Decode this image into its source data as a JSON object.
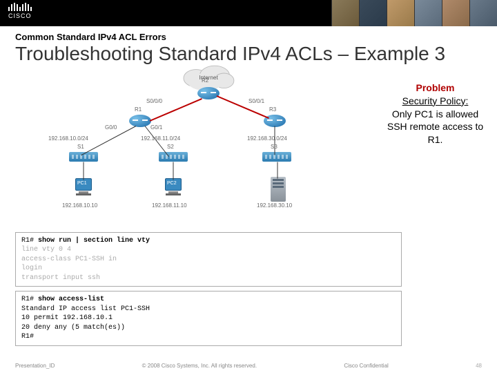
{
  "kicker": "Common Standard IPv4 ACL Errors",
  "title": "Troubleshooting Standard IPv4 ACLs – Example 3",
  "cloud": "Internet",
  "routers": {
    "r1": "R1",
    "r2": "R2",
    "r3": "R3"
  },
  "switches": {
    "s1": "S1",
    "s2": "S2",
    "s3": "S3"
  },
  "pcs": {
    "pc1": "PC1",
    "pc2": "PC2"
  },
  "ports": {
    "r1_g00": "G0/0",
    "r1_g01": "G0/1",
    "r1_s000": "S0/0/0",
    "r3_s001": "S0/0/1"
  },
  "nets": {
    "n10": "192.168.10.0/24",
    "n11": "192.168.11.0/24",
    "n30": "192.168.30.0/24"
  },
  "ips": {
    "pc1": "192.168.10.10",
    "pc2": "192.168.11.10",
    "srv": "192.168.30.10"
  },
  "problem": {
    "header": "Problem",
    "line1": "Security Policy:",
    "line2": "Only PC1 is allowed SSH remote access to R1."
  },
  "term1": {
    "prompt": "R1#",
    "cmd": "show run | section line vty",
    "l1": "line vty 0 4",
    "l2": " access-class PC1-SSH in",
    "l3": " login",
    "l4": " transport input ssh"
  },
  "term2": {
    "prompt": "R1#",
    "cmd": "show access-list",
    "l1": "Standard IP access list PC1-SSH",
    "l2": "    10 permit 192.168.10.1",
    "l3": "    20 deny   any (5 match(es))",
    "prompt2": "R1#"
  },
  "footer": {
    "left": "Presentation_ID",
    "center": "© 2008 Cisco Systems, Inc. All rights reserved.",
    "right": "Cisco Confidential",
    "page": "48"
  }
}
